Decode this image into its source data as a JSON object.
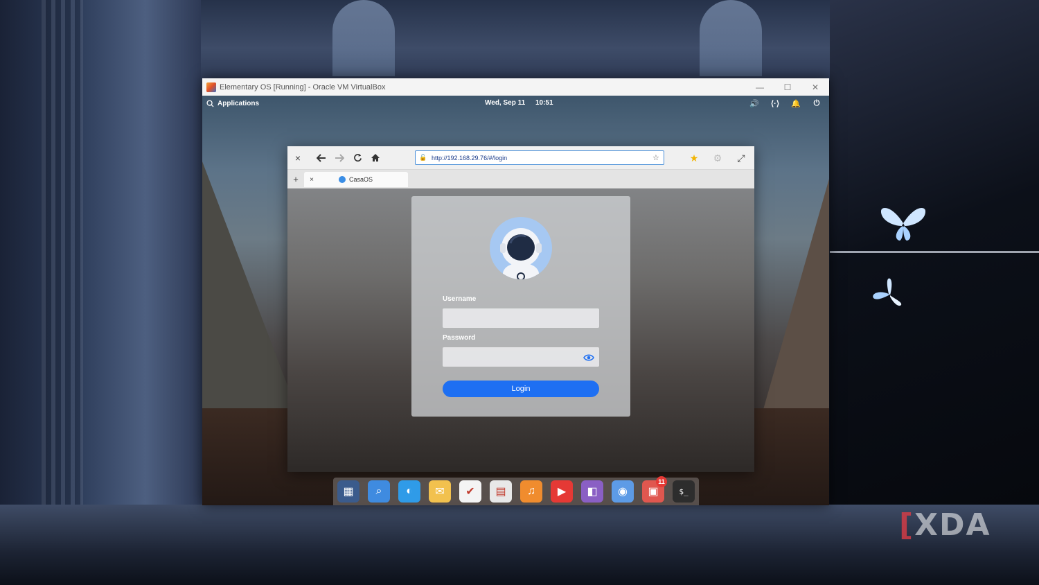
{
  "host": {
    "watermark": "XDA"
  },
  "vbox": {
    "title": "Elementary OS [Running] - Oracle VM VirtualBox",
    "controls": {
      "minimize": "—",
      "maximize": "☐",
      "close": "✕"
    }
  },
  "panel": {
    "applications_label": "Applications",
    "date": "Wed, Sep 11",
    "time": "10:51"
  },
  "browser": {
    "url": "http://192.168.29.76/#/login",
    "tab_title": "CasaOS",
    "new_tab_label": "+",
    "tab_close_label": "×",
    "close_label": "×"
  },
  "login": {
    "username_label": "Username",
    "username_value": "",
    "password_label": "Password",
    "password_value": "",
    "button_label": "Login"
  },
  "dock": {
    "items": [
      {
        "name": "multitasking-view",
        "color": "#3b5b8c"
      },
      {
        "name": "files",
        "color": "#3f8be0"
      },
      {
        "name": "web-browser",
        "color": "#2f9be8"
      },
      {
        "name": "mail",
        "color": "#f2c14e"
      },
      {
        "name": "tasks",
        "color": "#f4f4f4"
      },
      {
        "name": "calendar",
        "color": "#e8e8e8"
      },
      {
        "name": "music",
        "color": "#f08c2e"
      },
      {
        "name": "videos",
        "color": "#e53935"
      },
      {
        "name": "photos",
        "color": "#8a5fc4"
      },
      {
        "name": "system-settings",
        "color": "#5d9be6"
      },
      {
        "name": "appcenter",
        "color": "#e0574f",
        "badge": "11"
      },
      {
        "name": "terminal",
        "color": "#2d2d2d",
        "label": "$_"
      }
    ]
  },
  "colors": {
    "accent": "#1e6ff2",
    "avatar_bg": "#a6c8f2"
  }
}
